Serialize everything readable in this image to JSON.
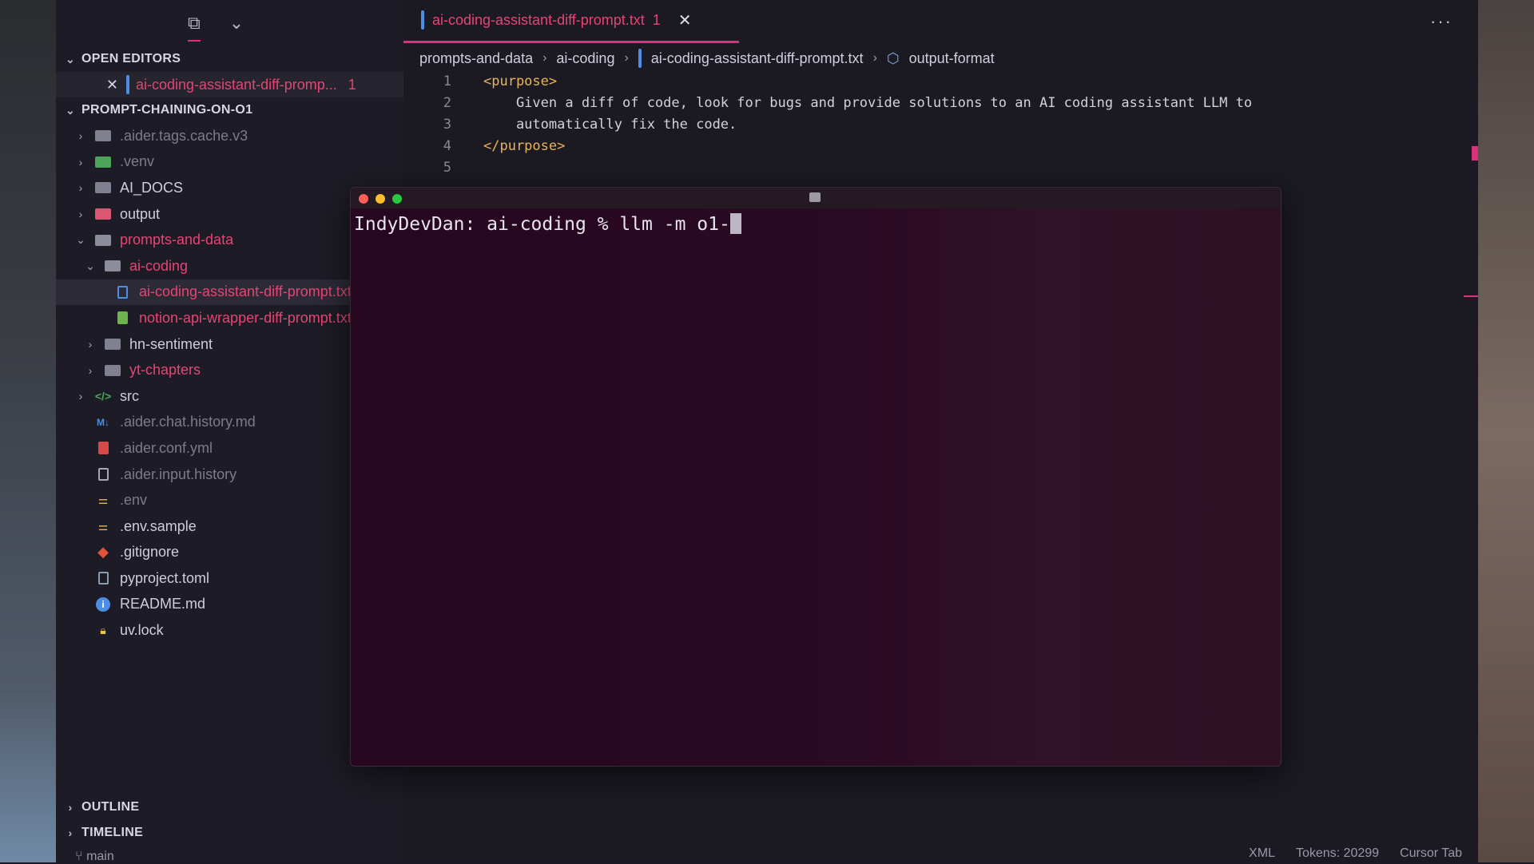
{
  "sidebar": {
    "open_editors_title": "OPEN EDITORS",
    "open_editor": {
      "name": "ai-coding-assistant-diff-promp...",
      "badge": "1"
    },
    "project_title": "PROMPT-CHAINING-ON-O1",
    "tree": [
      {
        "label": ".aider.tags.cache.v3"
      },
      {
        "label": ".venv"
      },
      {
        "label": "AI_DOCS"
      },
      {
        "label": "output"
      },
      {
        "label": "prompts-and-data"
      },
      {
        "label": "ai-coding"
      },
      {
        "label": "ai-coding-assistant-diff-prompt.txt"
      },
      {
        "label": "notion-api-wrapper-diff-prompt.txt"
      },
      {
        "label": "hn-sentiment"
      },
      {
        "label": "yt-chapters"
      },
      {
        "label": "src"
      },
      {
        "label": ".aider.chat.history.md"
      },
      {
        "label": ".aider.conf.yml"
      },
      {
        "label": ".aider.input.history"
      },
      {
        "label": ".env"
      },
      {
        "label": ".env.sample"
      },
      {
        "label": ".gitignore"
      },
      {
        "label": "pyproject.toml"
      },
      {
        "label": "README.md"
      },
      {
        "label": "uv.lock"
      }
    ],
    "outline_title": "OUTLINE",
    "timeline_title": "TIMELINE",
    "branch": "main"
  },
  "editor": {
    "tab": {
      "name": "ai-coding-assistant-diff-prompt.txt",
      "badge": "1",
      "close": "✕"
    },
    "more": "···",
    "breadcrumb": [
      "prompts-and-data",
      "ai-coding",
      "ai-coding-assistant-diff-prompt.txt",
      "output-format"
    ],
    "lines": [
      {
        "n": "1",
        "open": "<purpose>",
        "text": ""
      },
      {
        "n": "2",
        "text": "    Given a diff of code, look for bugs and provide solutions to an AI coding assistant LLM to"
      },
      {
        "n": "3",
        "text": "    automatically fix the code."
      },
      {
        "n": "4",
        "close": "</purpose>",
        "text": ""
      },
      {
        "n": "5",
        "text": ""
      }
    ]
  },
  "terminal": {
    "prompt": "IndyDevDan: ai-coding % llm -m o1-"
  },
  "status": {
    "language": "XML",
    "tokens": "Tokens: 20299",
    "cursor_tab": "Cursor Tab"
  },
  "colors": {
    "accent": "#d9327a",
    "error_text": "#e64473",
    "tag": "#e8b45a"
  }
}
